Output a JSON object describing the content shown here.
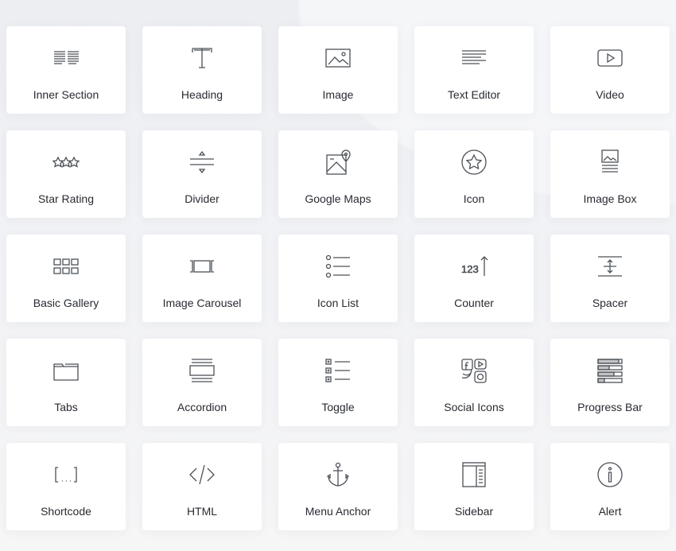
{
  "colors": {
    "icon": "#4c5157",
    "label": "#272b31",
    "card": "#ffffff"
  },
  "widgets": [
    {
      "label": "Inner Section",
      "icon": "inner-section-icon"
    },
    {
      "label": "Heading",
      "icon": "heading-icon"
    },
    {
      "label": "Image",
      "icon": "image-icon"
    },
    {
      "label": "Text Editor",
      "icon": "text-editor-icon"
    },
    {
      "label": "Video",
      "icon": "video-icon"
    },
    {
      "label": "Star Rating",
      "icon": "star-rating-icon"
    },
    {
      "label": "Divider",
      "icon": "divider-icon"
    },
    {
      "label": "Google Maps",
      "icon": "google-maps-icon"
    },
    {
      "label": "Icon",
      "icon": "star-circle-icon"
    },
    {
      "label": "Image Box",
      "icon": "image-box-icon"
    },
    {
      "label": "Basic Gallery",
      "icon": "gallery-icon"
    },
    {
      "label": "Image Carousel",
      "icon": "carousel-icon"
    },
    {
      "label": "Icon List",
      "icon": "icon-list-icon"
    },
    {
      "label": "Counter",
      "icon": "counter-icon"
    },
    {
      "label": "Spacer",
      "icon": "spacer-icon"
    },
    {
      "label": "Tabs",
      "icon": "tabs-icon"
    },
    {
      "label": "Accordion",
      "icon": "accordion-icon"
    },
    {
      "label": "Toggle",
      "icon": "toggle-icon"
    },
    {
      "label": "Social Icons",
      "icon": "social-icons-icon"
    },
    {
      "label": "Progress Bar",
      "icon": "progress-bar-icon"
    },
    {
      "label": "Shortcode",
      "icon": "shortcode-icon"
    },
    {
      "label": "HTML",
      "icon": "code-icon"
    },
    {
      "label": "Menu Anchor",
      "icon": "anchor-icon"
    },
    {
      "label": "Sidebar",
      "icon": "sidebar-icon"
    },
    {
      "label": "Alert",
      "icon": "info-icon"
    }
  ]
}
